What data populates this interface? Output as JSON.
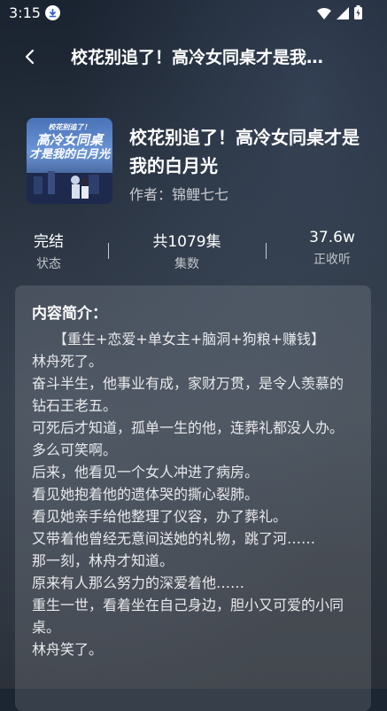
{
  "status_bar": {
    "time": "3:15"
  },
  "header": {
    "title": "校花别追了！高冷女同桌才是我…"
  },
  "book": {
    "cover_title_lines": [
      "校花别追了！",
      "高冷女同桌",
      "才是我的白月光"
    ],
    "title": "校花别追了！高冷女同桌才是我的白月光",
    "author": "作者：锦鲤七七"
  },
  "stats": [
    {
      "value": "完结",
      "label": "状态"
    },
    {
      "value": "共1079集",
      "label": "集数"
    },
    {
      "value": "37.6w",
      "label": "正收听"
    }
  ],
  "intro": {
    "heading": "内容简介：",
    "lines": [
      "　　【重生+恋爱+单女主+脑洞+狗粮+赚钱】",
      "林舟死了。",
      "奋斗半生，他事业有成，家财万贯，是令人羡慕的钻石王老五。",
      "可死后才知道，孤单一生的他，连葬礼都没人办。",
      "多么可笑啊。",
      "后来，他看见一个女人冲进了病房。",
      "看见她抱着他的遗体哭的撕心裂肺。",
      "看见她亲手给他整理了仪容，办了葬礼。",
      "又带着他曾经无意间送她的礼物，跳了河……",
      "那一刻，林舟才知道。",
      "原来有人那么努力的深爱着他……",
      "重生一世，看着坐在自己身边，胆小又可爱的小同桌。",
      "林舟笑了。"
    ]
  }
}
